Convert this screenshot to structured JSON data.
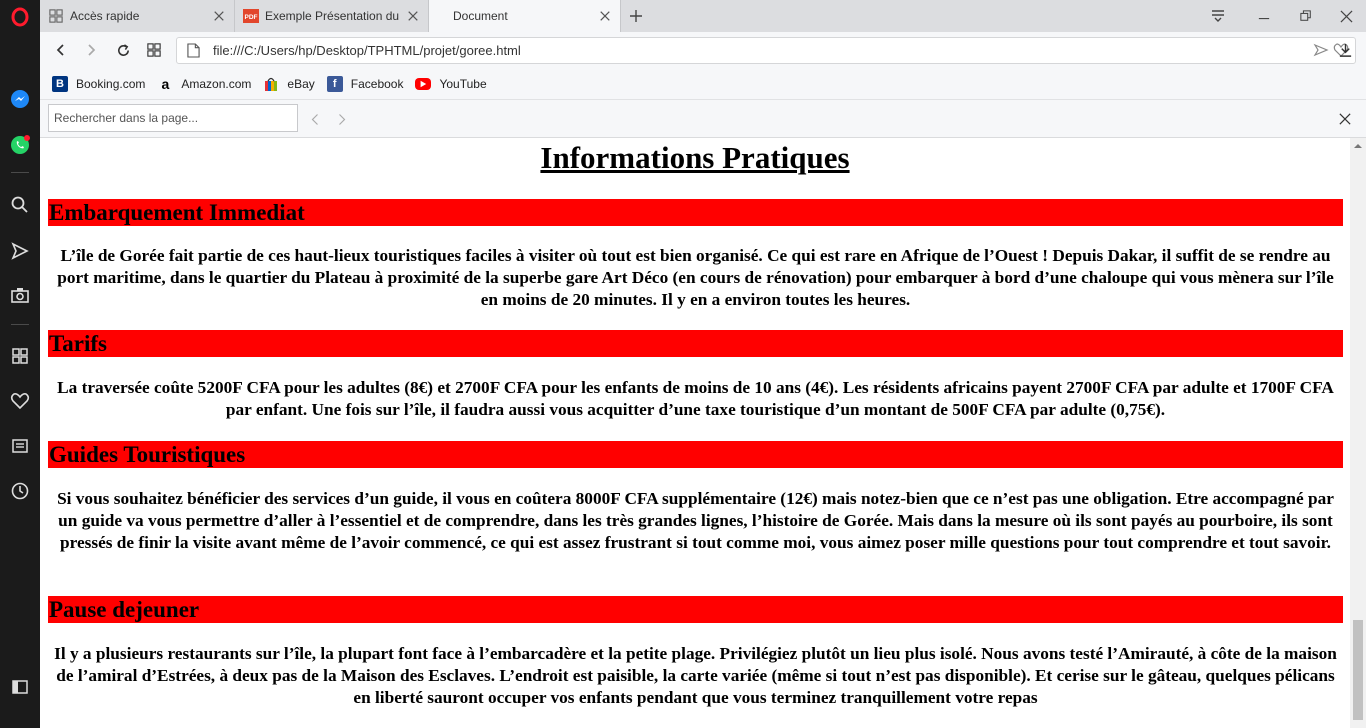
{
  "browser": {
    "tabs": [
      {
        "title": "Accès rapide",
        "icon": "opera-grid-icon",
        "active": false
      },
      {
        "title": "Exemple Présentation du p",
        "icon": "pdf-icon",
        "active": false
      },
      {
        "title": "Document",
        "icon": "none",
        "active": true
      }
    ],
    "url": "file:///C:/Users/hp/Desktop/TPHTML/projet/goree.html",
    "bookmarks": [
      {
        "label": "Booking.com",
        "icon": "booking-icon",
        "color": "#003580"
      },
      {
        "label": "Amazon.com",
        "icon": "amazon-icon",
        "color": "#000000"
      },
      {
        "label": "eBay",
        "icon": "ebay-icon",
        "color": "#e53238"
      },
      {
        "label": "Facebook",
        "icon": "facebook-icon",
        "color": "#3b5998"
      },
      {
        "label": "YouTube",
        "icon": "youtube-icon",
        "color": "#ff0000"
      }
    ],
    "find": {
      "placeholder": "Rechercher dans la page..."
    }
  },
  "page": {
    "title": "Informations Pratiques",
    "sections": [
      {
        "heading": "Embarquement Immediat",
        "text": "L’île de Gorée fait partie de ces haut-lieux touristiques faciles à visiter où tout est bien organisé. Ce qui est rare en Afrique de l’Ouest ! Depuis Dakar, il suffit de se rendre au port maritime, dans le quartier du Plateau à proximité de la superbe gare Art Déco (en cours de rénovation) pour embarquer à bord d’une chaloupe qui vous mènera sur l’île en moins de 20 minutes. Il y en a environ toutes les heures."
      },
      {
        "heading": "Tarifs",
        "text": "La traversée coûte 5200F CFA pour les adultes (8€) et 2700F CFA pour les enfants de moins de 10 ans (4€). Les résidents africains payent 2700F CFA par adulte et 1700F CFA par enfant. Une fois sur l’île, il faudra aussi vous acquitter d’une taxe touristique d’un montant de 500F CFA par adulte (0,75€)."
      },
      {
        "heading": "Guides Touristiques",
        "text": "Si vous souhaitez bénéficier des services d’un guide, il vous en coûtera 8000F CFA supplémentaire (12€) mais notez-bien que ce n’est pas une obligation. Etre accompagné par un guide va vous permettre d’aller à l’essentiel et de comprendre, dans les très grandes lignes, l’histoire de Gorée. Mais dans la mesure où ils sont payés au pourboire, ils sont pressés de finir la visite avant même de l’avoir commencé, ce qui est assez frustrant si tout comme moi, vous aimez poser mille questions pour tout comprendre et tout savoir."
      },
      {
        "heading": "Pause dejeuner",
        "text": "Il y a plusieurs restaurants sur l’île, la plupart font face à l’embarcadère et la petite plage. Privilégiez plutôt un lieu plus isolé. Nous avons testé l’Amirauté, à côte de la maison de l’amiral d’Estrées, à deux pas de la Maison des Esclaves. L’endroit est paisible, la carte variée (même si tout n’est pas disponible). Et cerise sur le gâteau, quelques pélicans en liberté sauront occuper vos enfants pendant que vous terminez tranquillement votre repas"
      }
    ]
  },
  "colors": {
    "heading_bg": "#ff0000",
    "sidebar_bg": "#1b1b1b",
    "opera_red": "#ff1b2d"
  }
}
